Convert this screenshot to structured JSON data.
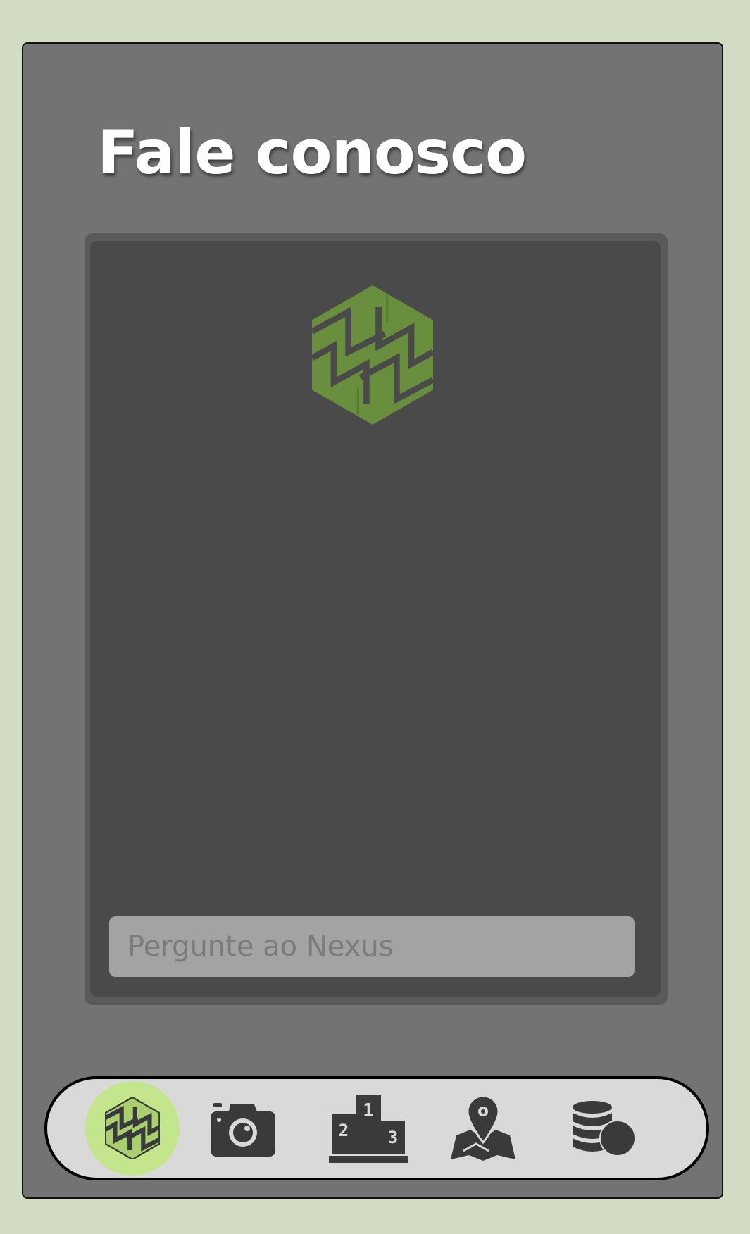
{
  "page": {
    "title": "Fale conosco"
  },
  "chat": {
    "logo_icon": "nexus-hexagon-logo",
    "input_placeholder": "Pergunte ao Nexus",
    "input_value": ""
  },
  "bottom_nav": {
    "active_index": 0,
    "items": [
      {
        "icon": "nexus-hexagon-icon",
        "active": true
      },
      {
        "icon": "camera-icon",
        "active": false
      },
      {
        "icon": "podium-ranking-icon",
        "active": false
      },
      {
        "icon": "map-pin-icon",
        "active": false
      },
      {
        "icon": "coins-stack-icon",
        "active": false
      }
    ]
  },
  "colors": {
    "page_background": "#d2dbc3",
    "frame_background": "#737373",
    "chat_background": "#4a4a4a",
    "input_background": "#a3a3a3",
    "nav_background": "#d9d9d9",
    "active_nav_highlight": "#c3e58b",
    "brand_green": "#6a9a3c"
  }
}
